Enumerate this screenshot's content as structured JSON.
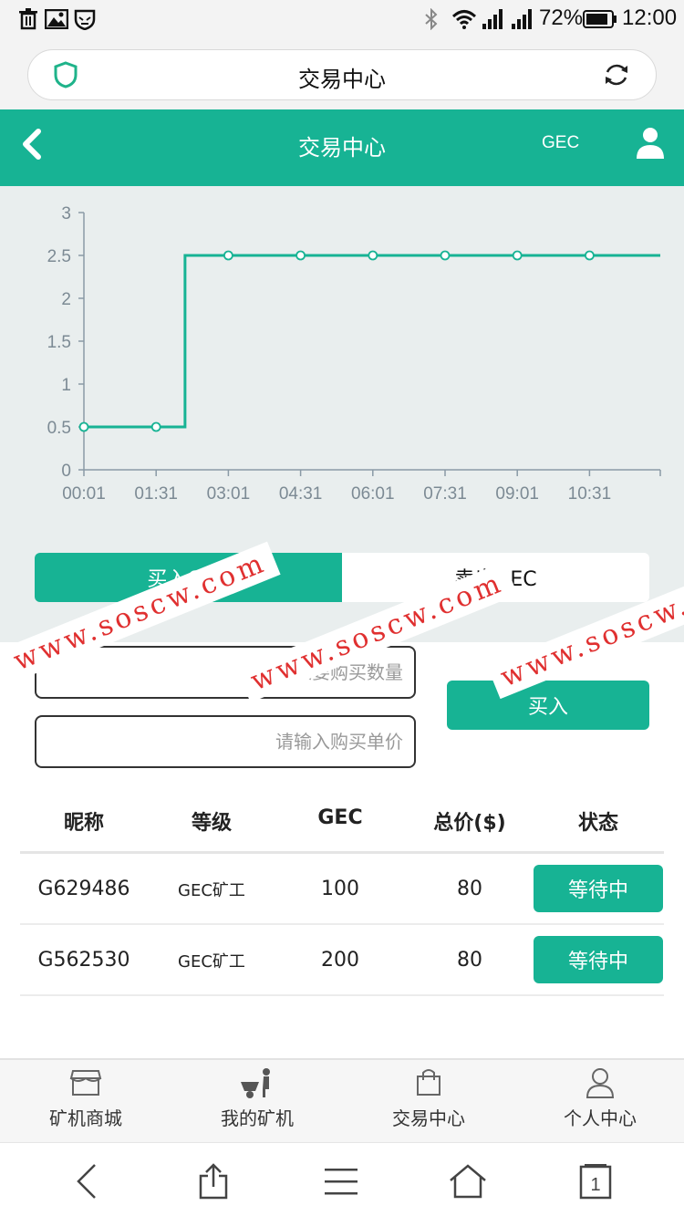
{
  "status_bar": {
    "left_icons": [
      "trash-icon",
      "image-icon",
      "shield-cat-icon"
    ],
    "right_icons": [
      "bluetooth-icon",
      "wifi-icon",
      "signal-icon",
      "signal-icon"
    ],
    "battery": "72%",
    "time": "12:00"
  },
  "browser": {
    "title": "交易中心",
    "left_icon": "shield-icon",
    "right_icon": "refresh-icon"
  },
  "header": {
    "title": "交易中心",
    "coin": "GEC",
    "back_icon": "back-chevron-icon",
    "user_icon": "user-icon",
    "accent": "#17b394"
  },
  "chart_data": {
    "type": "line",
    "x": [
      "00:01",
      "01:31",
      "03:01",
      "04:31",
      "06:01",
      "07:31",
      "09:01",
      "10:31"
    ],
    "series": [
      {
        "values": [
          0.5,
          0.5,
          2.5,
          2.5,
          2.5,
          2.5,
          2.5,
          2.5
        ]
      }
    ],
    "yticks": [
      "0",
      "0.5",
      "1",
      "1.5",
      "2",
      "2.5",
      "3"
    ],
    "ylim": [
      0,
      3
    ],
    "step": true,
    "color": "#17b394",
    "grid": false
  },
  "tabs": {
    "buy": "买入GEC",
    "sell": "卖出GEC"
  },
  "form": {
    "quantity_placeholder": "请输入要购买数量",
    "price_placeholder": "请输入购买单价",
    "buy_button": "买入"
  },
  "table": {
    "headers": [
      "昵称",
      "等级",
      "GEC",
      "总价($)",
      "状态"
    ],
    "rows": [
      {
        "nickname": "G629486",
        "level": "GEC矿工",
        "gec": "100",
        "total": "80",
        "status": "等待中"
      },
      {
        "nickname": "G562530",
        "level": "GEC矿工",
        "gec": "200",
        "total": "80",
        "status": "等待中"
      }
    ]
  },
  "app_nav": [
    {
      "label": "矿机商城",
      "icon": "store-icon"
    },
    {
      "label": "我的矿机",
      "icon": "miner-icon"
    },
    {
      "label": "交易中心",
      "icon": "bag-icon"
    },
    {
      "label": "个人中心",
      "icon": "person-icon"
    }
  ],
  "browser_nav": {
    "tab_count": "1",
    "icons": [
      "back-icon",
      "share-icon",
      "menu-icon",
      "home-icon",
      "tabs-icon"
    ]
  },
  "watermark": "www.soscw.com"
}
